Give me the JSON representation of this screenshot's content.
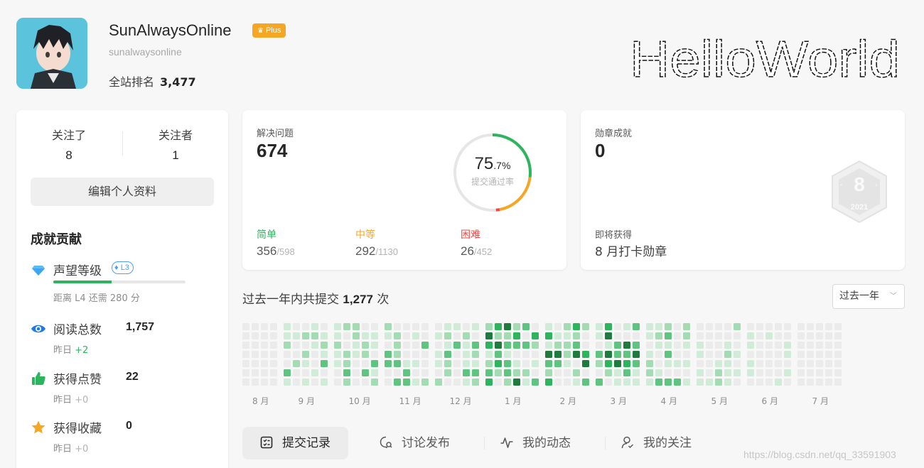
{
  "profile": {
    "username": "SunAlwaysOnline",
    "plus_label": "Plus",
    "handle": "sunalwaysonline",
    "rank_label": "全站排名",
    "rank_value": "3,477",
    "banner_text": "HelloWorld"
  },
  "follow": {
    "following_label": "关注了",
    "following_count": "8",
    "followers_label": "关注者",
    "followers_count": "1"
  },
  "edit_profile_label": "编辑个人资料",
  "contrib": {
    "title": "成就贡献",
    "reputation": {
      "label": "声望等级",
      "level": "L3",
      "progress": 0.44,
      "note": "距离 L4 还需 280 分"
    },
    "reads": {
      "label": "阅读总数",
      "value": "1,757",
      "note_prefix": "昨日",
      "note_delta": "+2"
    },
    "likes": {
      "label": "获得点赞",
      "value": "22",
      "note_prefix": "昨日",
      "note_delta": "+0"
    },
    "favorites": {
      "label": "获得收藏",
      "value": "0",
      "note_prefix": "昨日",
      "note_delta": "+0"
    }
  },
  "solved": {
    "label": "解决问题",
    "value": "674",
    "rate_main": "75",
    "rate_dec": ".7%",
    "rate_label": "提交通过率",
    "rate": 0.757,
    "easy": {
      "label": "简单",
      "solved": "356",
      "total": "/598"
    },
    "medium": {
      "label": "中等",
      "solved": "292",
      "total": "/1130"
    },
    "hard": {
      "label": "困难",
      "solved": "26",
      "total": "/452"
    }
  },
  "badges": {
    "label": "勋章成就",
    "value": "0",
    "next_label": "即将获得",
    "next_value": "8 月打卡勋章",
    "hex_number": "8",
    "hex_year": "2021"
  },
  "submissions": {
    "prefix": "过去一年内共提交",
    "count": "1,277",
    "suffix": "次",
    "range_label": "过去一年",
    "months": [
      "8 月",
      "9 月",
      "10 月",
      "11 月",
      "12 月",
      "1 月",
      "2 月",
      "3 月",
      "4 月",
      "5 月",
      "6 月",
      "7 月"
    ]
  },
  "tabs": [
    {
      "label": "提交记录",
      "icon": "list-check-icon"
    },
    {
      "label": "讨论发布",
      "icon": "discussion-icon"
    },
    {
      "label": "我的动态",
      "icon": "activity-icon"
    },
    {
      "label": "我的关注",
      "icon": "user-follow-icon"
    }
  ],
  "watermark": "https://blog.csdn.net/qq_33591903",
  "colors": {
    "green": "#2db55d",
    "orange": "#f5a623",
    "red": "#ef4743",
    "blue": "#4a9ff5",
    "heat": [
      "#ebebeb",
      "#d0ecd8",
      "#a3dbb3",
      "#5fc47f",
      "#2db55d",
      "#1f7a3e"
    ]
  }
}
